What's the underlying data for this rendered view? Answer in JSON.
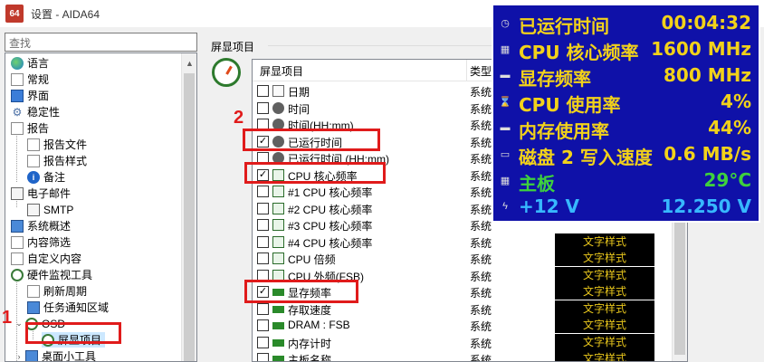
{
  "window": {
    "app_icon_text": "64",
    "title": "设置 - AIDA64"
  },
  "search": {
    "placeholder": "查找"
  },
  "tree": {
    "items": [
      {
        "label": "语言",
        "icon": "globe-icon"
      },
      {
        "label": "常规",
        "icon": "window-icon"
      },
      {
        "label": "界面",
        "icon": "monitor-icon"
      },
      {
        "label": "稳定性",
        "icon": "gear-icon"
      },
      {
        "label": "报告",
        "icon": "report-icon"
      },
      {
        "label": "报告文件",
        "icon": "document-icon"
      },
      {
        "label": "报告样式",
        "icon": "document-icon"
      },
      {
        "label": "备注",
        "icon": "info-icon"
      },
      {
        "label": "电子邮件",
        "icon": "mail-icon"
      },
      {
        "label": "SMTP",
        "icon": "mail-icon"
      },
      {
        "label": "系统概述",
        "icon": "monitor-icon"
      },
      {
        "label": "内容筛选",
        "icon": "filter-icon"
      },
      {
        "label": "自定义内容",
        "icon": "document-icon"
      },
      {
        "label": "硬件监视工具",
        "icon": "gauge-icon"
      },
      {
        "label": "刷新周期",
        "icon": "clock-icon"
      },
      {
        "label": "任务通知区域",
        "icon": "taskbar-icon"
      },
      {
        "label": "OSD",
        "icon": "gauge-icon"
      },
      {
        "label": "屏显项目",
        "icon": "gauge-icon"
      },
      {
        "label": "桌面小工具",
        "icon": "monitor-icon"
      }
    ]
  },
  "panel": {
    "group_label": "屏显项目",
    "columns": {
      "item": "屏显项目",
      "type": "类型"
    },
    "rows": [
      {
        "checked": false,
        "icon": "calendar-icon",
        "name": "日期",
        "type": "系统",
        "style": ""
      },
      {
        "checked": false,
        "icon": "clock-icon",
        "name": "时间",
        "type": "系统",
        "style": ""
      },
      {
        "checked": false,
        "icon": "clock-icon",
        "name": "时间(HH:mm)",
        "type": "系统",
        "style": ""
      },
      {
        "checked": true,
        "icon": "clock-icon",
        "name": "已运行时间",
        "type": "系统",
        "style": ""
      },
      {
        "checked": false,
        "icon": "clock-icon",
        "name": "已运行时间 (HH:mm)",
        "type": "系统",
        "style": ""
      },
      {
        "checked": true,
        "icon": "chip-icon",
        "name": "CPU 核心频率",
        "type": "系统",
        "style": ""
      },
      {
        "checked": false,
        "icon": "chip-icon",
        "name": "#1 CPU 核心频率",
        "type": "系统",
        "style": ""
      },
      {
        "checked": false,
        "icon": "chip-icon",
        "name": "#2 CPU 核心频率",
        "type": "系统",
        "style": ""
      },
      {
        "checked": false,
        "icon": "chip-icon",
        "name": "#3 CPU 核心频率",
        "type": "系统",
        "style": ""
      },
      {
        "checked": false,
        "icon": "chip-icon",
        "name": "#4 CPU 核心频率",
        "type": "系统",
        "style": "文字样式"
      },
      {
        "checked": false,
        "icon": "chip-icon",
        "name": "CPU 倍频",
        "type": "系统",
        "style": "文字样式"
      },
      {
        "checked": false,
        "icon": "chip-icon",
        "name": "CPU 外频(FSB)",
        "type": "系统",
        "style": "文字样式"
      },
      {
        "checked": true,
        "icon": "ram-icon",
        "name": "显存频率",
        "type": "系统",
        "style": "文字样式"
      },
      {
        "checked": false,
        "icon": "ram-icon",
        "name": "存取速度",
        "type": "系统",
        "style": "文字样式"
      },
      {
        "checked": false,
        "icon": "ram-icon",
        "name": "DRAM : FSB",
        "type": "系统",
        "style": "文字样式"
      },
      {
        "checked": false,
        "icon": "ram-icon",
        "name": "内存计时",
        "type": "系统",
        "style": "文字样式"
      },
      {
        "checked": false,
        "icon": "ram-icon",
        "name": "主板名称",
        "type": "系统",
        "style": "文字样式"
      }
    ]
  },
  "annotations": {
    "n1": "1",
    "n2": "2"
  },
  "osd": {
    "rows": [
      {
        "label": "已运行时间",
        "value": "00:04:32",
        "color": "#f2d21a",
        "icon": "clock-icon"
      },
      {
        "label": "CPU 核心频率",
        "value": "1600 MHz",
        "color": "#f2d21a",
        "icon": "chip-icon"
      },
      {
        "label": "显存频率",
        "value": "800 MHz",
        "color": "#f2d21a",
        "icon": "ram-icon"
      },
      {
        "label": "CPU 使用率",
        "value": "4%",
        "color": "#f2d21a",
        "icon": "hourglass-icon"
      },
      {
        "label": "内存使用率",
        "value": "44%",
        "color": "#f2d21a",
        "icon": "ram-icon"
      },
      {
        "label": "磁盘 2 写入速度",
        "value": "0.6 MB/s",
        "color": "#f2d21a",
        "icon": "disk-icon"
      },
      {
        "label": "主板",
        "value": "29°C",
        "color": "#3ed13e",
        "icon": "motherboard-icon"
      },
      {
        "label": "+12 V",
        "value": "12.250 V",
        "color": "#37b8ff",
        "icon": "voltage-icon"
      }
    ]
  }
}
